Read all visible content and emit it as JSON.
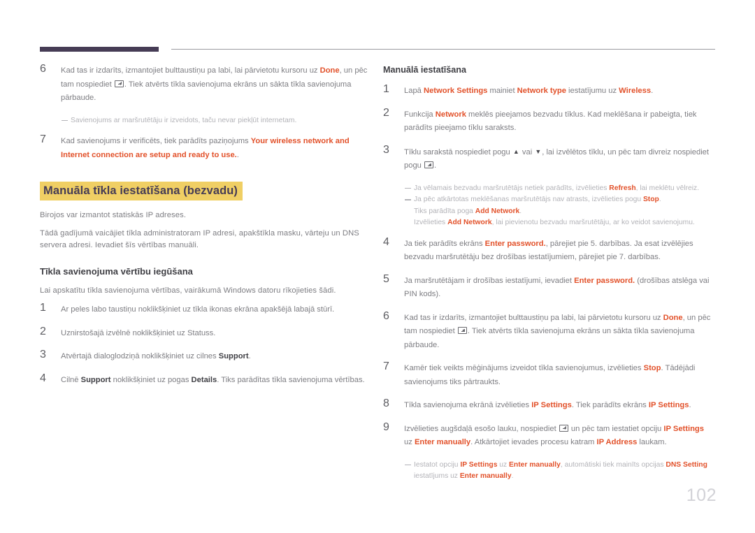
{
  "document": {
    "page_number": "102",
    "accent_highlight_color": "#e2512a",
    "heading_highlight_bg": "#f0cf64",
    "heading_highlight_fg": "#463c55",
    "header_bar_color": "#463c55"
  },
  "left_column": {
    "steps_top": [
      {
        "number": "6",
        "parts": [
          {
            "t": "Kad tas ir izdarīts, izmantojiet bulttaustiņu pa labi, lai pārvietotu kursoru uz ",
            "s": "n"
          },
          {
            "t": "Done",
            "s": "hi"
          },
          {
            "t": ", un pēc tam nospiediet ",
            "s": "n"
          },
          {
            "t": "",
            "s": "key"
          },
          {
            "t": ". Tiek atvērts tīkla savienojuma ekrāns un sākta tīkla savienojuma pārbaude.",
            "s": "n"
          }
        ]
      }
    ],
    "note_after_step6": [
      {
        "dash": true,
        "parts": [
          {
            "t": "Savienojums ar maršrutētāju ir izveidots, taču nevar piekļūt internetam.",
            "s": "n"
          }
        ]
      }
    ],
    "steps_bottom": [
      {
        "number": "7",
        "parts": [
          {
            "t": "Kad savienojums ir verificēts, tiek parādīts paziņojums ",
            "s": "n"
          },
          {
            "t": "Your wireless network and Internet connection are setup and ready to use.",
            "s": "hi"
          },
          {
            "t": ".",
            "s": "n"
          }
        ]
      }
    ],
    "section_heading": "Manuāla tīkla iestatīšana (bezvadu)",
    "paragraphs": [
      "Birojos var izmantot statiskās IP adreses.",
      "Tādā gadījumā vaicājiet tīkla administratoram IP adresi, apakštīkla masku, vārteju un DNS servera adresi. Ievadiet šīs vērtības manuāli."
    ],
    "sub_heading": "Tīkla savienojuma vērtību iegūšana",
    "sub_paragraph": "Lai apskatītu tīkla savienojuma vērtības, vairākumā Windows datoru rīkojieties šādi.",
    "steps_values": [
      {
        "number": "1",
        "parts": [
          {
            "t": "Ar peles labo taustiņu noklikšķiniet uz tīkla ikonas ekrāna apakšējā labajā stūrī.",
            "s": "n"
          }
        ]
      },
      {
        "number": "2",
        "parts": [
          {
            "t": "Uznirstošajā izvēlnē noklikšķiniet uz Statuss.",
            "s": "n"
          }
        ]
      },
      {
        "number": "3",
        "parts": [
          {
            "t": "Atvērtajā dialoglodziņā noklikšķiniet uz cilnes ",
            "s": "n"
          },
          {
            "t": "Support",
            "s": "dk"
          },
          {
            "t": ".",
            "s": "n"
          }
        ]
      },
      {
        "number": "4",
        "parts": [
          {
            "t": "Cilnē ",
            "s": "n"
          },
          {
            "t": "Support",
            "s": "dk"
          },
          {
            "t": " noklikšķiniet uz pogas ",
            "s": "n"
          },
          {
            "t": "Details",
            "s": "dk"
          },
          {
            "t": ". Tiks parādītas tīkla savienojuma vērtības.",
            "s": "n"
          }
        ]
      }
    ]
  },
  "right_column": {
    "heading": "Manuālā iestatīšana",
    "steps": [
      {
        "number": "1",
        "parts": [
          {
            "t": "Lapā ",
            "s": "n"
          },
          {
            "t": "Network Settings",
            "s": "hi"
          },
          {
            "t": " mainiet ",
            "s": "n"
          },
          {
            "t": "Network type",
            "s": "hi"
          },
          {
            "t": " iestatījumu uz ",
            "s": "n"
          },
          {
            "t": "Wireless",
            "s": "hi"
          },
          {
            "t": ".",
            "s": "n"
          }
        ]
      },
      {
        "number": "2",
        "parts": [
          {
            "t": "Funkcija ",
            "s": "n"
          },
          {
            "t": "Network",
            "s": "hi"
          },
          {
            "t": " meklēs pieejamos bezvadu tīklus. Kad meklēšana ir pabeigta, tiek parādīts pieejamo tīklu saraksts.",
            "s": "n"
          }
        ]
      },
      {
        "number": "3",
        "parts": [
          {
            "t": "Tīklu sarakstā nospiediet pogu ",
            "s": "n"
          },
          {
            "t": "▲",
            "s": "up"
          },
          {
            "t": " vai ",
            "s": "n"
          },
          {
            "t": "▼",
            "s": "dn"
          },
          {
            "t": ", lai izvēlētos tīklu, un pēc tam divreiz nospiediet pogu ",
            "s": "n"
          },
          {
            "t": "",
            "s": "key"
          },
          {
            "t": ".",
            "s": "n"
          }
        ]
      }
    ],
    "note_after_step3": [
      {
        "dash": true,
        "parts": [
          {
            "t": "Ja vēlamais bezvadu maršrutētājs netiek parādīts, izvēlieties ",
            "s": "n"
          },
          {
            "t": "Refresh",
            "s": "hi"
          },
          {
            "t": ", lai meklētu vēlreiz.",
            "s": "n"
          }
        ]
      },
      {
        "dash": true,
        "parts": [
          {
            "t": "Ja pēc atkārtotas meklēšanas maršrutētājs nav atrasts, izvēlieties pogu ",
            "s": "n"
          },
          {
            "t": "Stop",
            "s": "hi"
          },
          {
            "t": ".",
            "s": "n"
          }
        ]
      },
      {
        "dash": false,
        "parts": [
          {
            "t": "Tiks parādīta poga ",
            "s": "n"
          },
          {
            "t": "Add Network",
            "s": "hi"
          },
          {
            "t": ".",
            "s": "n"
          }
        ]
      },
      {
        "dash": false,
        "parts": [
          {
            "t": "Izvēlieties ",
            "s": "n"
          },
          {
            "t": "Add Network",
            "s": "hi"
          },
          {
            "t": ", lai pievienotu bezvadu maršrutētāju, ar ko veidot savienojumu.",
            "s": "n"
          }
        ]
      }
    ],
    "steps_cont": [
      {
        "number": "4",
        "parts": [
          {
            "t": "Ja tiek parādīts ekrāns ",
            "s": "n"
          },
          {
            "t": "Enter password.",
            "s": "hi"
          },
          {
            "t": ", pārejiet pie 5. darbības. Ja esat izvēlējies bezvadu maršrutētāju bez drošības iestatījumiem, pārejiet pie 7. darbības.",
            "s": "n"
          }
        ]
      },
      {
        "number": "5",
        "parts": [
          {
            "t": "Ja maršrutētājam ir drošības iestatījumi, ievadiet ",
            "s": "n"
          },
          {
            "t": "Enter password.",
            "s": "hi"
          },
          {
            "t": " (drošības atslēga vai PIN kods).",
            "s": "n"
          }
        ]
      },
      {
        "number": "6",
        "parts": [
          {
            "t": "Kad tas ir izdarīts, izmantojiet bulttaustiņu pa labi, lai pārvietotu kursoru uz ",
            "s": "n"
          },
          {
            "t": "Done",
            "s": "hi"
          },
          {
            "t": ", un pēc tam nospiediet ",
            "s": "n"
          },
          {
            "t": "",
            "s": "key"
          },
          {
            "t": ". Tiek atvērts tīkla savienojuma ekrāns un sākta tīkla savienojuma pārbaude.",
            "s": "n"
          }
        ]
      },
      {
        "number": "7",
        "parts": [
          {
            "t": "Kamēr tiek veikts mēģinājums izveidot tīkla savienojumus, izvēlieties ",
            "s": "n"
          },
          {
            "t": "Stop",
            "s": "hi"
          },
          {
            "t": ". Tādējādi savienojums tiks pārtraukts.",
            "s": "n"
          }
        ]
      },
      {
        "number": "8",
        "parts": [
          {
            "t": "Tīkla savienojuma ekrānā izvēlieties ",
            "s": "n"
          },
          {
            "t": "IP Settings",
            "s": "hi"
          },
          {
            "t": ". Tiek parādīts ekrāns ",
            "s": "n"
          },
          {
            "t": "IP Settings",
            "s": "hi"
          },
          {
            "t": ".",
            "s": "n"
          }
        ]
      },
      {
        "number": "9",
        "parts": [
          {
            "t": "Izvēlieties augšdaļā esošo lauku, nospiediet ",
            "s": "n"
          },
          {
            "t": "",
            "s": "key"
          },
          {
            "t": " un pēc tam iestatiet opciju ",
            "s": "n"
          },
          {
            "t": "IP Settings",
            "s": "hi"
          },
          {
            "t": " uz ",
            "s": "n"
          },
          {
            "t": "Enter manually",
            "s": "hi"
          },
          {
            "t": ". Atkārtojiet ievades procesu katram ",
            "s": "n"
          },
          {
            "t": "IP Address",
            "s": "hi"
          },
          {
            "t": " laukam.",
            "s": "n"
          }
        ]
      }
    ],
    "note_after_step9": [
      {
        "dash": true,
        "parts": [
          {
            "t": "Iestatot opciju ",
            "s": "n"
          },
          {
            "t": "IP Settings",
            "s": "hi"
          },
          {
            "t": " uz ",
            "s": "n"
          },
          {
            "t": "Enter manually",
            "s": "hi"
          },
          {
            "t": ", automātiski tiek mainīts opcijas ",
            "s": "n"
          },
          {
            "t": "DNS Setting",
            "s": "hi"
          },
          {
            "t": "",
            "s": "n"
          }
        ]
      },
      {
        "dash": false,
        "parts": [
          {
            "t": "iestatījums uz ",
            "s": "n"
          },
          {
            "t": "Enter manually",
            "s": "hi"
          },
          {
            "t": ".",
            "s": "n"
          }
        ]
      }
    ]
  }
}
